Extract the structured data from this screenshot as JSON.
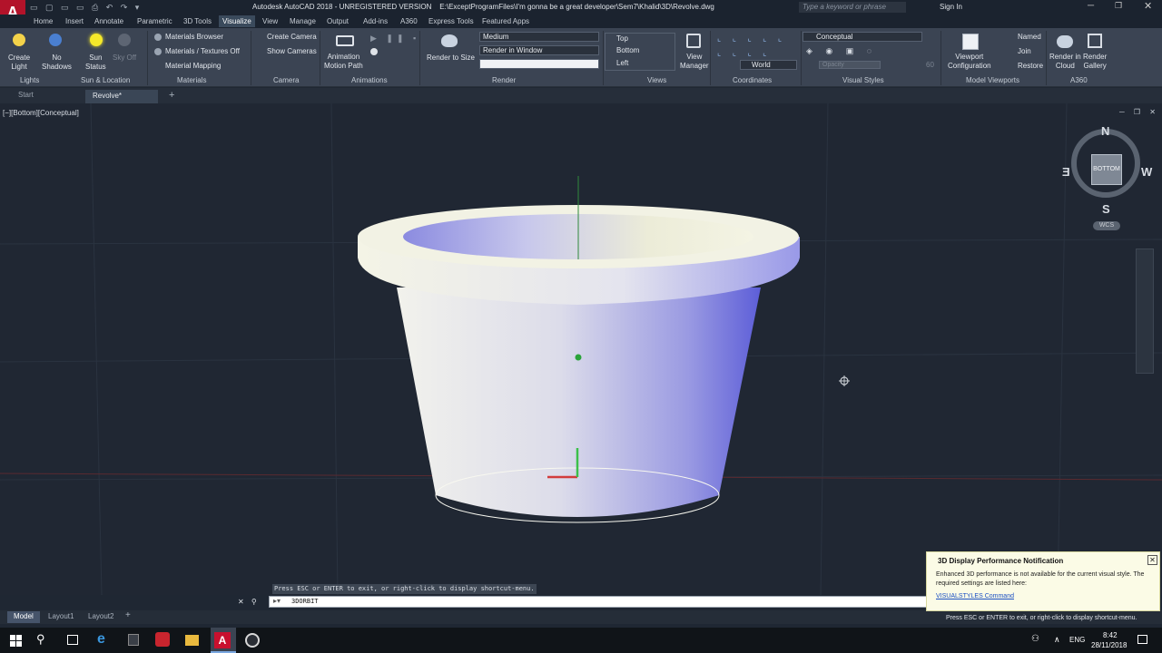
{
  "app": {
    "title": "Autodesk AutoCAD 2018 - UNREGISTERED VERSION    E:\\ExceptProgramFiles\\I'm gonna be a great developer\\Sem7\\Khalid\\3D\\Revolve.dwg",
    "search_placeholder": "Type a keyword or phrase",
    "sign_in": "Sign In",
    "logo_letter": "A"
  },
  "ribbon_tabs": [
    "Home",
    "Insert",
    "Annotate",
    "Parametric",
    "3D Tools",
    "Visualize",
    "View",
    "Manage",
    "Output",
    "Add-ins",
    "A360",
    "Express Tools",
    "Featured Apps"
  ],
  "ribbon": {
    "lights": {
      "create_light": "Create\nLight",
      "no_shadows": "No\nShadows",
      "sun_status": "Sun\nStatus",
      "sky_off": "Sky Off"
    },
    "materials": {
      "browser": "Materials Browser",
      "textures": "Materials / Textures Off",
      "mapping": "Material Mapping"
    },
    "camera": {
      "create": "Create Camera",
      "show": "Show  Cameras"
    },
    "animations": {
      "motion_path": "Animation\nMotion Path"
    },
    "render": {
      "to_size": "Render to Size",
      "quality": "Medium",
      "target": "Render in Window"
    },
    "views": {
      "top": "Top",
      "bottom": "Bottom",
      "left": "Left",
      "view_manager": "View\nManager"
    },
    "coordinates": {
      "ucs": "World"
    },
    "visual_styles": {
      "style": "Conceptual",
      "opacity_placeholder": "Opacity",
      "opacity_value": "60"
    },
    "model_viewports": {
      "viewport_config": "Viewport\nConfiguration",
      "named": "Named",
      "join": "Join",
      "restore": "Restore"
    },
    "a360": {
      "render_cloud": "Render in\nCloud",
      "render_gallery": "Render\nGallery"
    },
    "panel_titles": {
      "lights": "Lights",
      "sun_location": "Sun & Location",
      "materials": "Materials",
      "camera": "Camera",
      "animations": "Animations",
      "render": "Render",
      "views": "Views",
      "coordinates": "Coordinates",
      "visual_styles": "Visual Styles",
      "model_viewports": "Model Viewports",
      "a360": "A360"
    }
  },
  "file_tabs": [
    "Start",
    "Revolve*"
  ],
  "viewport": {
    "label": "[−][Bottom][Conceptual]",
    "viewcube": {
      "north": "N",
      "south": "S",
      "east": "E",
      "west": "W",
      "face": "BOTTOM",
      "wcs": "WCS"
    }
  },
  "command": {
    "prompt_hint": "Press ESC or ENTER to exit, or right-click to display shortcut-menu.",
    "input": "3DORBIT"
  },
  "layout_tabs": [
    "Model",
    "Layout1",
    "Layout2"
  ],
  "notification": {
    "title": "3D Display Performance Notification",
    "body": "Enhanced 3D performance is not available for the current visual style. The required settings are listed here:",
    "link": "VISUALSTYLES Command"
  },
  "status_hint": "Press ESC or ENTER to exit, or right-click to display shortcut-menu.",
  "taskbar": {
    "language": "ENG",
    "time": "8:42",
    "date": "28/11/2018"
  }
}
